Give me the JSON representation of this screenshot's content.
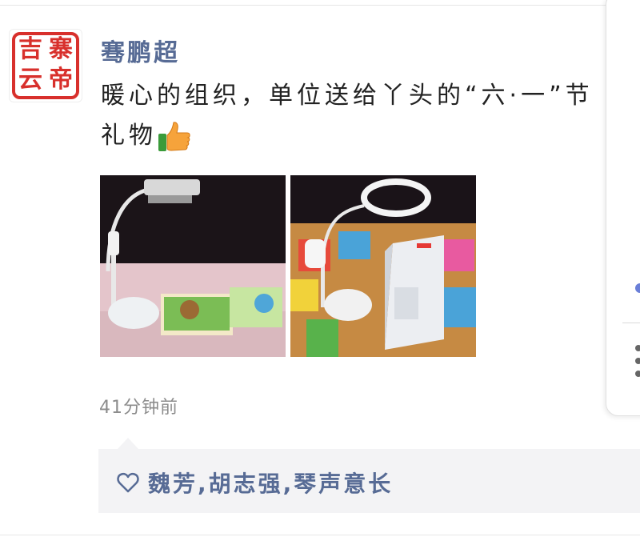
{
  "post": {
    "author": "骞鹏超",
    "avatar_seal_chars": [
      "寨",
      "吉",
      "帝",
      "云"
    ],
    "text": "暖心的组织，单位送给丫头的“六·一”节礼物",
    "emoji": "thumbs-up",
    "photos": [
      {
        "subject": "desk-lamp-and-picture-books"
      },
      {
        "subject": "ring-lamp-and-product-box"
      }
    ],
    "timestamp": "41分钟前"
  },
  "likes": {
    "icon": "heart-outline-icon",
    "names": "魏芳,胡志强,琴声意长"
  },
  "colors": {
    "name_link": "#576b95",
    "text": "#222222",
    "muted": "#8c8c8c",
    "like_bg": "#f3f3f5",
    "seal_red": "#d8302c"
  }
}
